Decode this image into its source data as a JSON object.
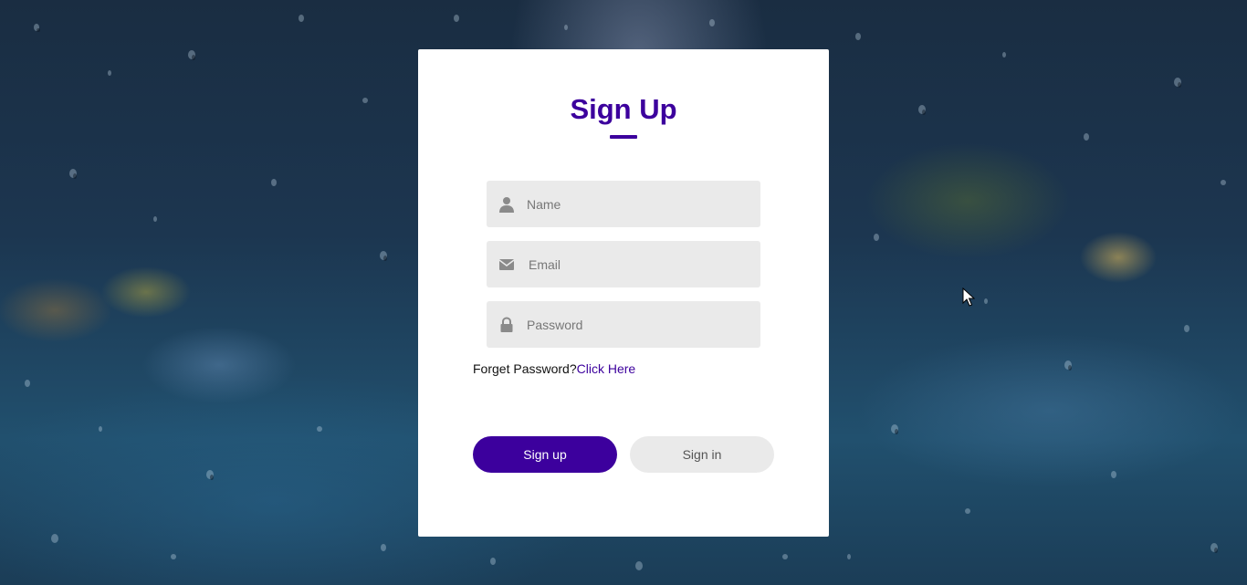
{
  "form": {
    "title": "Sign Up",
    "name_placeholder": "Name",
    "email_placeholder": "Email",
    "password_placeholder": "Password",
    "forgot_text": "Forget Password?",
    "forgot_link": "Click Here",
    "signup_label": "Sign up",
    "signin_label": "Sign in"
  },
  "icons": {
    "name": "user-icon",
    "email": "envelope-icon",
    "password": "lock-icon"
  },
  "colors": {
    "accent": "#3c009d",
    "field_bg": "#eaeaea",
    "secondary_button": "#eaeaea",
    "card_bg": "#ffffff"
  }
}
